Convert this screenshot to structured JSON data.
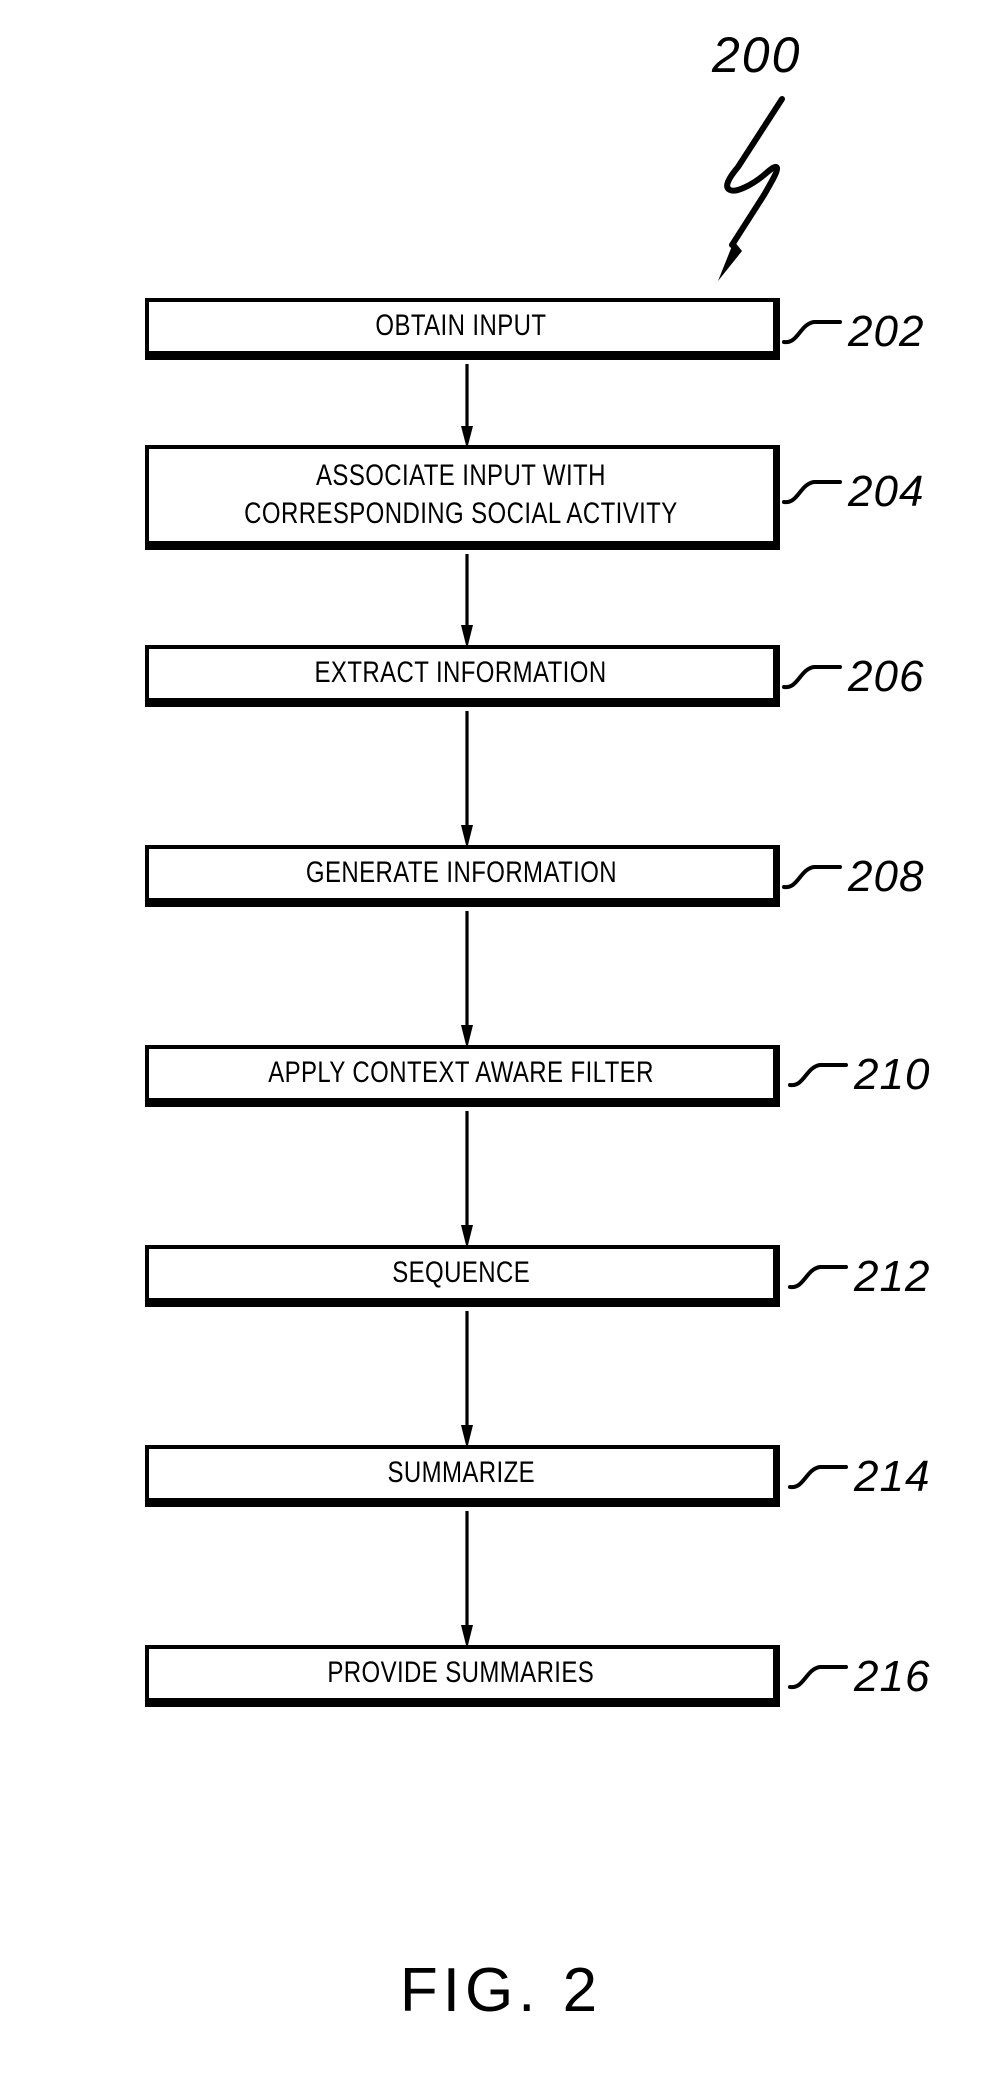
{
  "figure": {
    "caption": "FIG. 2",
    "reference_number": "200",
    "leader_icon": "lightning-bolt-leader-icon"
  },
  "flowchart": {
    "type": "process-flow",
    "direction": "top-to-bottom",
    "steps": [
      {
        "ref": "202",
        "label": "OBTAIN INPUT",
        "lines": 1
      },
      {
        "ref": "204",
        "label": "ASSOCIATE INPUT WITH\nCORRESPONDING SOCIAL ACTIVITY",
        "lines": 2
      },
      {
        "ref": "206",
        "label": "EXTRACT INFORMATION",
        "lines": 1
      },
      {
        "ref": "208",
        "label": "GENERATE INFORMATION",
        "lines": 1
      },
      {
        "ref": "210",
        "label": "APPLY CONTEXT AWARE FILTER",
        "lines": 1
      },
      {
        "ref": "212",
        "label": "SEQUENCE",
        "lines": 1
      },
      {
        "ref": "214",
        "label": "SUMMARIZE",
        "lines": 1
      },
      {
        "ref": "216",
        "label": "PROVIDE SUMMARIES",
        "lines": 1
      }
    ],
    "connectors": [
      {
        "from": "202",
        "to": "204",
        "arrow": "down-arrow-icon"
      },
      {
        "from": "204",
        "to": "206",
        "arrow": "down-arrow-icon"
      },
      {
        "from": "206",
        "to": "208",
        "arrow": "down-arrow-icon"
      },
      {
        "from": "208",
        "to": "210",
        "arrow": "down-arrow-icon"
      },
      {
        "from": "210",
        "to": "212",
        "arrow": "down-arrow-icon"
      },
      {
        "from": "212",
        "to": "214",
        "arrow": "down-arrow-icon"
      },
      {
        "from": "214",
        "to": "216",
        "arrow": "down-arrow-icon"
      }
    ]
  },
  "colors": {
    "ink": "#000000",
    "background": "#ffffff"
  }
}
